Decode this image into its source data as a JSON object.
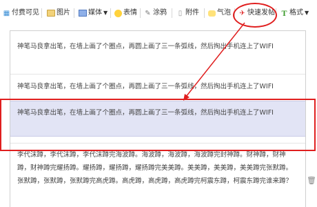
{
  "toolbar": {
    "items": [
      {
        "label": "付费可见",
        "icon": "qr-icon"
      },
      {
        "label": "图片",
        "icon": "picture-icon"
      },
      {
        "label": "媒体",
        "icon": "media-icon"
      },
      {
        "label": "表情",
        "icon": "emoji-icon"
      },
      {
        "label": "涂鸦",
        "icon": "doodle-icon"
      },
      {
        "label": "附件",
        "icon": "attachment-icon"
      },
      {
        "label": "气泡",
        "icon": "bubble-icon"
      },
      {
        "label": "快速发帖",
        "icon": "quick-post-icon"
      },
      {
        "label": "格式",
        "icon": "format-icon"
      }
    ],
    "highlight_color": "#e01e1e"
  },
  "panel": {
    "items": [
      {
        "text": "神笔马良拿出笔，在墙上画了个圈点，再圆上画了三一条弧线，然后掏出手机连上了WIFI"
      },
      {
        "text": "神笔马良拿出笔，在墙上画了个圈点，再圆上画了三一条弧线，然后掏出手机连上了WIFI"
      },
      {
        "text": "神笔马良拿出笔，在墙上画了个圈点，再圆上画了三一条弧线，然后掏出手机连上了WIFI"
      },
      {
        "text": "李代沫蹲，李代沫蹲，李代沫蹲完海波蹲。海波蹲，海波蹲，海波蹲完封神蹲。财神蹲，财神蹲，财神蹲完耀扬蹲。耀扬蹲，耀扬蹲，耀扬蹲完美美蹲。美美蹲，美美蹲，美美蹲完张默蹲。张默蹲，张默蹲，张默蹲完高虎蹲。高虎蹲，高虎蹲，高虎蹲完柯震东蹲，柯震东蹲完谁来蹲？"
      }
    ],
    "selected_bg": "#e2e4f5"
  }
}
